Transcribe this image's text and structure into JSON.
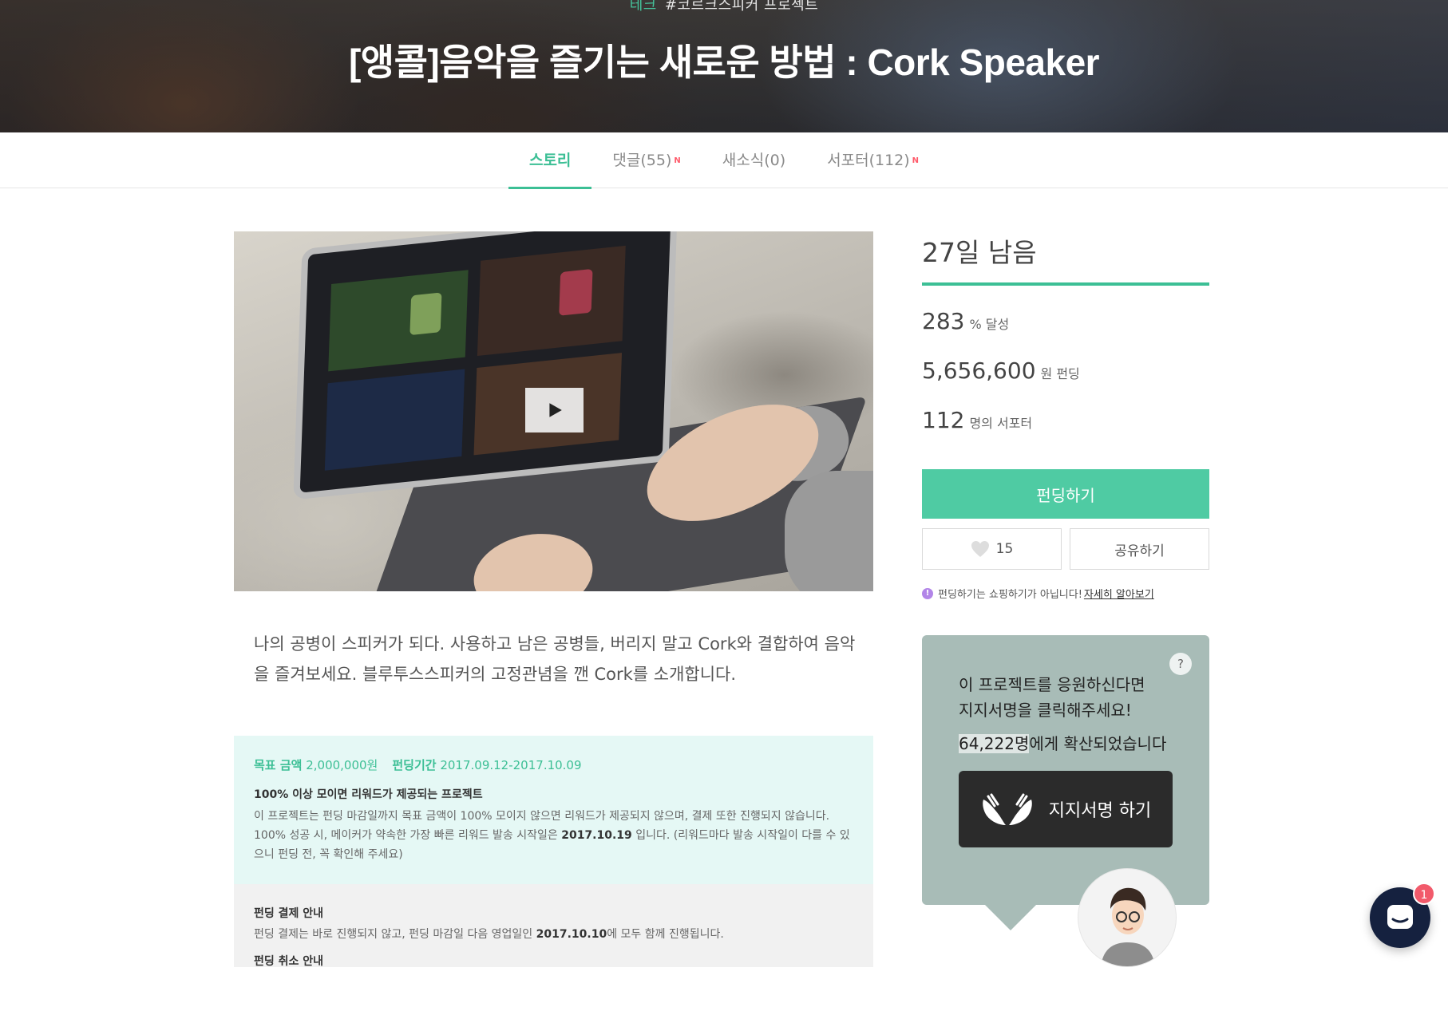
{
  "hero": {
    "category": "테크",
    "tag": "#코르크스피커 프로젝트",
    "title": "[앵콜]음악을 즐기는 새로운 방법 : Cork Speaker"
  },
  "tabs": [
    {
      "label": "스토리",
      "active": true,
      "new": false
    },
    {
      "label": "댓글(55)",
      "active": false,
      "new": true,
      "new_label": "N"
    },
    {
      "label": "새소식(0)",
      "active": false,
      "new": false
    },
    {
      "label": "서포터(112)",
      "active": false,
      "new": true,
      "new_label": "N"
    }
  ],
  "video": {
    "play_icon": "play-icon"
  },
  "summary": "나의 공병이 스피커가 되다. 사용하고 남은 공병들, 버리지 말고 Cork와 결합하여 음악을 즐겨보세요. 블루투스스피커의 고정관념을 깬 Cork를 소개합니다.",
  "info": {
    "goal_label": "목표 금액",
    "goal_value": "2,000,000원",
    "period_label": "펀딩기간",
    "period_value": "2017.09.12-2017.10.09",
    "heading": "100% 이상 모이면 리워드가 제공되는 프로젝트",
    "body_1": "이 프로젝트는 펀딩 마감일까지 목표 금액이 100% 모이지 않으면 리워드가 제공되지 않으며, 결제 또한 진행되지 않습니다.",
    "body_2a": "100% 성공 시, 메이커가 약속한 가장 빠른 리워드 발송 시작일은 ",
    "body_2_date": "2017.10.19",
    "body_2b": " 입니다. (리워드마다 발송 시작일이 다를 수 있으니 펀딩 전, 꼭 확인해 주세요)",
    "payment_heading": "펀딩 결제 안내",
    "payment_a": "펀딩 결제는 바로 진행되지 않고, 펀딩 마감일 다음 영업일인 ",
    "payment_date": "2017.10.10",
    "payment_b": "에 모두 함께 진행됩니다.",
    "cancel_heading": "펀딩 취소 안내"
  },
  "stats": {
    "days_left": "27일 남음",
    "percent": "283",
    "percent_unit": "% 달성",
    "amount": "5,656,600",
    "amount_unit": "원 펀딩",
    "supporters": "112",
    "supporters_unit": "명의 서포터"
  },
  "buttons": {
    "fund": "펀딩하기",
    "like_count": "15",
    "share": "공유하기"
  },
  "notice": {
    "icon": "!",
    "text": "펀딩하기는 쇼핑하기가 아닙니다!",
    "link": "자세히 알아보기"
  },
  "petition": {
    "help": "?",
    "line1": "이 프로젝트를 응원하신다면",
    "line2": "지지서명을 클릭해주세요!",
    "count": "64,222명",
    "count_suffix": "에게 확산되었습니다",
    "button": "지지서명 하기"
  },
  "chat": {
    "badge": "1"
  },
  "colors": {
    "accent": "#3cbf95",
    "fund_button": "#4fcba3",
    "petition_bg": "#a8bcb7",
    "chat_bg": "#15213f",
    "badge": "#f25a6b"
  }
}
